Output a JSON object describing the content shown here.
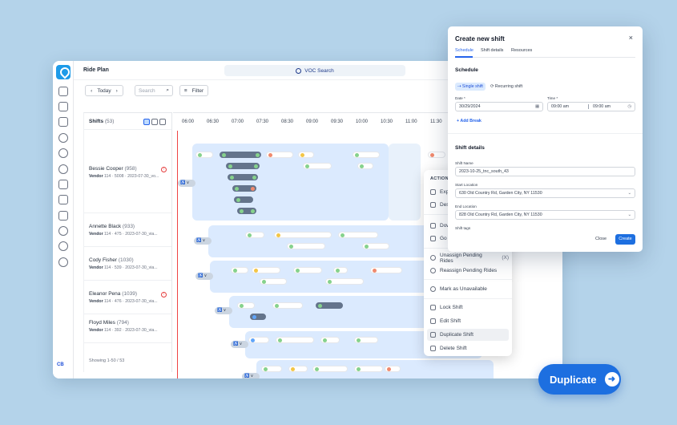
{
  "app": {
    "page_title": "Ride Plan",
    "search_label": "VOC Search",
    "avatar_initials": "CB"
  },
  "toolbar": {
    "today": "Today",
    "search_placeholder": "Search",
    "filter": "Filter"
  },
  "shifts": {
    "title": "Shifts",
    "count": "(53)",
    "showing": "Showing 1-50 / 53",
    "people": [
      {
        "name": "Bessie Cooper",
        "num": "(958)",
        "vendor": "Vendor",
        "meta": "114 · 5008 · 2023-07-30_vo..."
      },
      {
        "name": "Annette Black",
        "num": "(933)",
        "vendor": "Vendor",
        "meta": "114 · 475 · 2023-07-30_via..."
      },
      {
        "name": "Cody Fisher",
        "num": "(1030)",
        "vendor": "Vendor",
        "meta": "114 · 539 · 2023-07-30_via..."
      },
      {
        "name": "Eleanor Pena",
        "num": "(1039)",
        "vendor": "Vendor",
        "meta": "114 · 476 · 2023-07-30_via..."
      },
      {
        "name": "Floyd Miles",
        "num": "(794)",
        "vendor": "Vendor",
        "meta": "114 · 392 · 2023-07-30_via..."
      }
    ]
  },
  "timeline": {
    "hours": [
      "06:00",
      "06:30",
      "07:00",
      "07:30",
      "08:30",
      "09:00",
      "09:30",
      "10:00",
      "10:30",
      "11:00",
      "11:30"
    ]
  },
  "context_menu": {
    "header": "ACTION",
    "items": [
      {
        "label": "Exp"
      },
      {
        "label": "Des"
      },
      {
        "label": "Dow"
      },
      {
        "label": "Go"
      },
      {
        "label": "Unassign Pending Rides",
        "key": "(X)"
      },
      {
        "label": "Reassign Pending Rides"
      },
      {
        "label": "Mark as Unavailable"
      },
      {
        "label": "Lock Shift"
      },
      {
        "label": "Edit Shift"
      },
      {
        "label": "Duplicate Shift"
      },
      {
        "label": "Delete Shift"
      }
    ]
  },
  "dialog": {
    "title": "Create new shift",
    "close": "×",
    "tabs": [
      "Schedule",
      "Shift details",
      "Resources"
    ],
    "schedule_heading": "Schedule",
    "single_shift": "⇢ Single shift",
    "recurring_shift": "⟳ Recurring shift",
    "date_label": "Date *",
    "date_value": "30/29/2024",
    "time_label": "Time *",
    "time_from": "09:00 am",
    "time_to": "09:00 am",
    "add_break": "+ Add Break",
    "details_heading": "Shift details",
    "shift_name_label": "Shift Name",
    "shift_name_value": "2023-10-25_tnc_south_43",
    "start_label": "Start Location",
    "start_value": "630 Old Country Rd, Garden City, NY 11530",
    "end_label": "End Location",
    "end_value": "828 Old Country Rd, Garden City, NY 11530",
    "tags_label": "Shift tags",
    "close_btn": "Close",
    "create_btn": "Create"
  },
  "cta": {
    "label": "Duplicate",
    "arrow": "➜"
  }
}
